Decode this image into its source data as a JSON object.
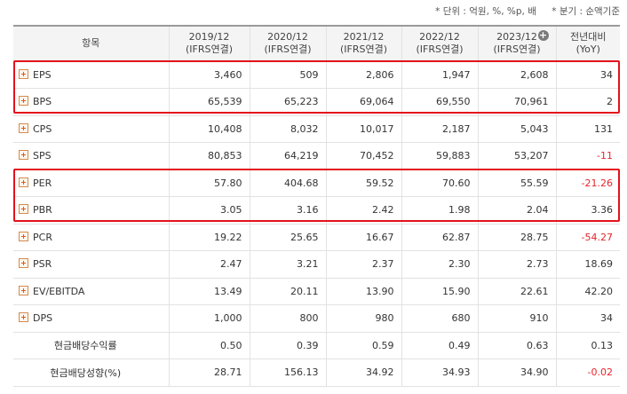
{
  "notes": {
    "unit": "* 단위 : 억원, %, %p, 배",
    "period": "* 분기 : 순액기준"
  },
  "header": {
    "item": "항목",
    "columns": [
      {
        "line1": "2019/12",
        "line2": "(IFRS연결)"
      },
      {
        "line1": "2020/12",
        "line2": "(IFRS연결)"
      },
      {
        "line1": "2021/12",
        "line2": "(IFRS연결)"
      },
      {
        "line1": "2022/12",
        "line2": "(IFRS연결)"
      },
      {
        "line1": "2023/12",
        "line2": "(IFRS연결)"
      },
      {
        "line1": "전년대비",
        "line2": "(YoY)"
      }
    ],
    "expand_icon": "plus-circle-icon"
  },
  "rows": [
    {
      "label": "EPS",
      "values": [
        "3,460",
        "509",
        "2,806",
        "1,947",
        "2,608",
        "34"
      ]
    },
    {
      "label": "BPS",
      "values": [
        "65,539",
        "65,223",
        "69,064",
        "69,550",
        "70,961",
        "2"
      ]
    },
    {
      "label": "CPS",
      "values": [
        "10,408",
        "8,032",
        "10,017",
        "2,187",
        "5,043",
        "131"
      ]
    },
    {
      "label": "SPS",
      "values": [
        "80,853",
        "64,219",
        "70,452",
        "59,883",
        "53,207",
        "-11"
      ]
    },
    {
      "label": "PER",
      "values": [
        "57.80",
        "404.68",
        "59.52",
        "70.60",
        "55.59",
        "-21.26"
      ]
    },
    {
      "label": "PBR",
      "values": [
        "3.05",
        "3.16",
        "2.42",
        "1.98",
        "2.04",
        "3.36"
      ]
    },
    {
      "label": "PCR",
      "values": [
        "19.22",
        "25.65",
        "16.67",
        "62.87",
        "28.75",
        "-54.27"
      ]
    },
    {
      "label": "PSR",
      "values": [
        "2.47",
        "3.21",
        "2.37",
        "2.30",
        "2.73",
        "18.69"
      ]
    },
    {
      "label": "EV/EBITDA",
      "values": [
        "13.49",
        "20.11",
        "13.90",
        "15.90",
        "22.61",
        "42.20"
      ]
    },
    {
      "label": "DPS",
      "values": [
        "1,000",
        "800",
        "980",
        "680",
        "910",
        "34"
      ]
    },
    {
      "label": "현금배당수익률",
      "values": [
        "0.50",
        "0.39",
        "0.59",
        "0.49",
        "0.63",
        "0.13"
      ]
    },
    {
      "label": "현금배당성향(%)",
      "values": [
        "28.71",
        "156.13",
        "34.92",
        "34.93",
        "34.90",
        "-0.02"
      ]
    }
  ],
  "colors": {
    "negative": "#e8242a",
    "highlight_box": "#e3121b",
    "expand_icon": "#e05a1a"
  }
}
